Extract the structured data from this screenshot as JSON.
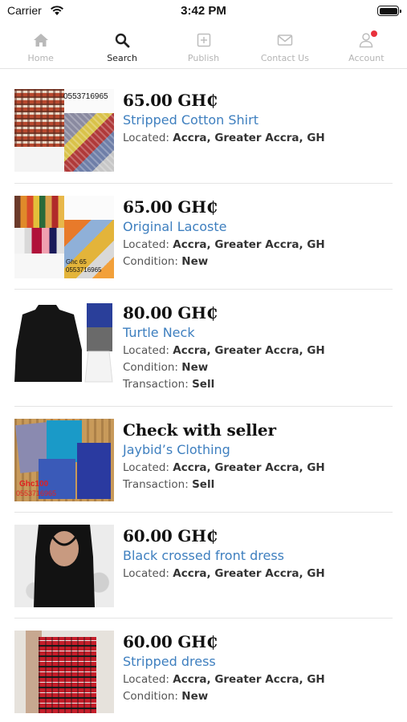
{
  "status_bar": {
    "carrier": "Carrier",
    "time": "3:42 PM"
  },
  "tabs": [
    {
      "label": "Home",
      "icon": "home-icon",
      "active": false
    },
    {
      "label": "Search",
      "icon": "search-icon",
      "active": true
    },
    {
      "label": "Publish",
      "icon": "plus-square-icon",
      "active": false
    },
    {
      "label": "Contact Us",
      "icon": "envelope-icon",
      "active": false
    },
    {
      "label": "Account",
      "icon": "user-icon",
      "active": false
    }
  ],
  "colors": {
    "link": "#3e7fbf",
    "notify": "#e8313c",
    "inactive_tab": "#b4b4b4"
  },
  "listings": [
    {
      "price": "65.00 GH₵",
      "title": "Stripped Cotton Shirt",
      "located_label": "Located:",
      "located": "Accra, Greater Accra, GH",
      "thumb_text": "0553716965"
    },
    {
      "price": "65.00 GH₵",
      "title": "Original Lacoste",
      "located_label": "Located:",
      "located": "Accra, Greater Accra, GH",
      "condition_label": "Condition:",
      "condition": "New",
      "thumb_text": "Ghc 65",
      "thumb_text2": "0553716965"
    },
    {
      "price": "80.00 GH₵",
      "title": "Turtle Neck",
      "located_label": "Located:",
      "located": "Accra, Greater Accra, GH",
      "condition_label": "Condition:",
      "condition": "New",
      "transaction_label": "Transaction:",
      "transaction": "Sell"
    },
    {
      "price": "Check with seller",
      "title": "Jaybid’s Clothing",
      "located_label": "Located:",
      "located": "Accra, Greater Accra, GH",
      "transaction_label": "Transaction:",
      "transaction": "Sell",
      "thumb_text": "Ghc100",
      "thumb_text2": "0553716965"
    },
    {
      "price": "60.00 GH₵",
      "title": "Black crossed front dress",
      "located_label": "Located:",
      "located": "Accra, Greater Accra, GH"
    },
    {
      "price": "60.00 GH₵",
      "title": "Stripped dress",
      "located_label": "Located:",
      "located": "Accra, Greater Accra, GH",
      "condition_label": "Condition:",
      "condition": "New"
    }
  ]
}
